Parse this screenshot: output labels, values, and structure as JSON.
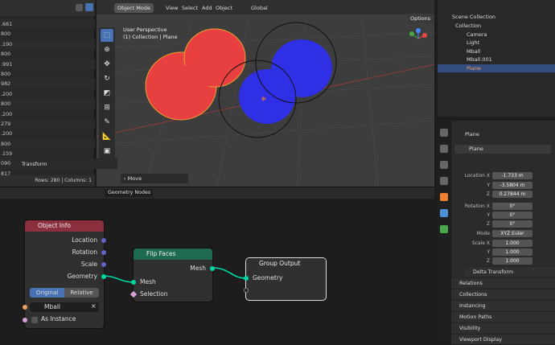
{
  "spreadsheet": {
    "values": [
      ".661",
      "800",
      ".190",
      "800",
      ".991",
      "800",
      "982",
      ".200",
      "800",
      ".200",
      "279",
      ".200",
      "800",
      ".159",
      "090",
      "817",
      "800"
    ],
    "footer": "Rows: 280  |  Columns: 1"
  },
  "viewport": {
    "mode": "Object Mode",
    "menus": [
      "View",
      "Select",
      "Add",
      "Object"
    ],
    "transform_orientation": "Global",
    "options_label": "Options",
    "perspective": "User Perspective",
    "collection_info": "(1) Collection | Plane",
    "last_op": "Move",
    "colors": {
      "red_blob": "#e84040",
      "blue_blob": "#2f2fe6"
    }
  },
  "outliner": {
    "header": "Scene Collection",
    "items": [
      {
        "label": "Collection",
        "color": "#dddddd"
      },
      {
        "label": "Camera",
        "color": "#dddddd"
      },
      {
        "label": "Light",
        "color": "#dddddd"
      },
      {
        "label": "Mball",
        "color": "#dddddd"
      },
      {
        "label": "Mball.001",
        "color": "#dddddd"
      },
      {
        "label": "Plane",
        "color": "#f0a060"
      }
    ]
  },
  "properties": {
    "object_name": "Plane",
    "data_name": "Plane",
    "transform_label": "Transform",
    "location": {
      "label": "Location X",
      "x": "-1.733 m",
      "y": "-3.5804 m",
      "z": "0.27844 m"
    },
    "rotation": {
      "label": "Rotation X",
      "x": "0°",
      "y": "0°",
      "z": "0°"
    },
    "mode": {
      "label": "Mode",
      "value": "XYZ Euler"
    },
    "scale": {
      "label": "Scale X",
      "x": "1.000",
      "y": "1.000",
      "z": "1.000"
    },
    "axis_y": "Y",
    "axis_z": "Z",
    "sections": [
      "Delta Transform",
      "Relations",
      "Collections",
      "Instancing",
      "Motion Paths",
      "Visibility",
      "Viewport Display"
    ]
  },
  "node_editor": {
    "tree_name": "Geometry Nodes",
    "object_info": {
      "title": "Object Info",
      "outputs": [
        "Location",
        "Rotation",
        "Scale",
        "Geometry"
      ],
      "toggle_original": "Original",
      "toggle_relative": "Relative",
      "object_value": "Mball",
      "as_instance": "As Instance"
    },
    "flip_faces": {
      "title": "Flip Faces",
      "output": "Mesh",
      "inputs": [
        "Mesh",
        "Selection"
      ]
    },
    "group_output": {
      "title": "Group Output",
      "input": "Geometry"
    },
    "colors": {
      "object_info_header": "#8b2e3e",
      "flip_header": "#1e6b52",
      "geometry_socket": "#00d6a3",
      "vector_socket": "#6363c7"
    }
  }
}
